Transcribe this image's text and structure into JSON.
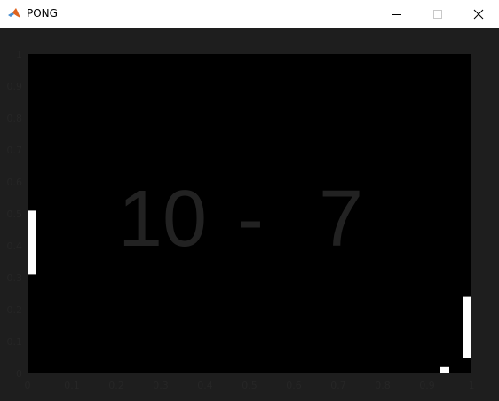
{
  "window": {
    "title": "PONG",
    "app_icon": "matlab-icon",
    "controls": {
      "minimize_icon": "minimize-icon",
      "maximize_icon": "maximize-icon",
      "close_icon": "close-icon"
    }
  },
  "colors": {
    "figure_background": "#1e1e1e",
    "axes_background": "#000000",
    "tick_label_color": "#262626",
    "score_color": "#222222",
    "paddle_color": "#ffffff",
    "ball_color": "#ffffff"
  },
  "game": {
    "score": {
      "left": "10",
      "separator": "-",
      "right": "7"
    },
    "left_paddle": {
      "x_range": [
        0.0,
        0.02
      ],
      "y_range": [
        0.31,
        0.51
      ]
    },
    "right_paddle": {
      "x_range": [
        0.98,
        1.0
      ],
      "y_range": [
        0.05,
        0.24
      ]
    },
    "ball": {
      "x_range": [
        0.93,
        0.95
      ],
      "y_range": [
        0.0,
        0.02
      ]
    }
  },
  "axes": {
    "xlim": [
      0,
      1
    ],
    "ylim": [
      0,
      1
    ],
    "x_ticks": [
      "0",
      "0.1",
      "0.2",
      "0.3",
      "0.4",
      "0.5",
      "0.6",
      "0.7",
      "0.8",
      "0.9",
      "1"
    ],
    "y_ticks": [
      "0",
      "0.1",
      "0.2",
      "0.3",
      "0.4",
      "0.5",
      "0.6",
      "0.7",
      "0.8",
      "0.9",
      "1"
    ]
  }
}
